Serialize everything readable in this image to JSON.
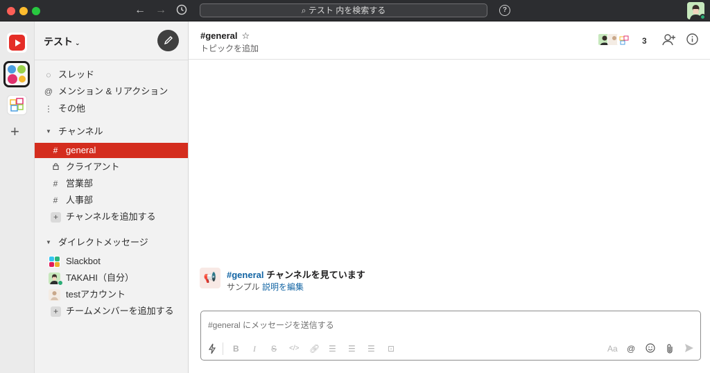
{
  "titlebar": {
    "search_text": "テスト 内を検索する",
    "back_icon": "arrow-left-icon",
    "forward_icon": "arrow-right-icon",
    "history_icon": "clock-icon",
    "help_icon": "question-circle-icon"
  },
  "rail": {
    "workspaces": [
      "youtube-workspace",
      "colorful-dots-workspace",
      "tiles-workspace"
    ],
    "add_label": "+"
  },
  "sidebar": {
    "workspace_name": "テスト",
    "workspace_chevron": "⌄",
    "nav": [
      {
        "icon": "thread-icon",
        "glyph": "◌",
        "label": "スレッド"
      },
      {
        "icon": "at-icon",
        "glyph": "@",
        "label": "メンション & リアクション"
      },
      {
        "icon": "more-vertical-icon",
        "glyph": "⋮",
        "label": "その他"
      }
    ],
    "channels_header": "チャンネル",
    "channels": [
      {
        "prefix": "#",
        "label": "general",
        "active": true
      },
      {
        "prefix": "🔒",
        "label": "クライアント",
        "active": false
      },
      {
        "prefix": "#",
        "label": "営業部",
        "active": false
      },
      {
        "prefix": "#",
        "label": "人事部",
        "active": false
      }
    ],
    "add_channel": "チャンネルを追加する",
    "dm_header": "ダイレクトメッセージ",
    "dms": [
      {
        "label": "Slackbot"
      },
      {
        "label": "TAKAHI（自分）"
      },
      {
        "label": "testアカウント"
      }
    ],
    "add_member": "チームメンバーを追加する"
  },
  "channel": {
    "name": "#general",
    "star": "☆",
    "topic": "トピックを追加",
    "member_count": "3"
  },
  "intro": {
    "channel_link": "#general",
    "title_rest": " チャンネルを見ています",
    "desc": "サンプル",
    "edit_link": "説明を編集"
  },
  "composer": {
    "placeholder": "#general にメッセージを送信する",
    "aa_label": "Aa",
    "at_label": "@"
  },
  "colors": {
    "active_channel": "#d42d1e",
    "link": "#1264a3",
    "titlebar": "#2c2d30",
    "sidebar": "#f2f2f2",
    "presence": "#2bac76"
  }
}
